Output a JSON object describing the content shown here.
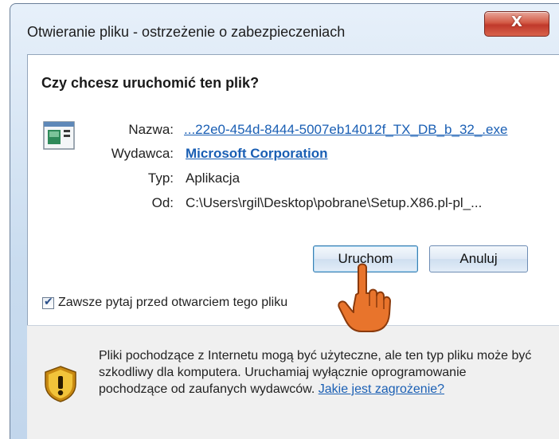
{
  "window": {
    "title": "Otwieranie pliku - ostrzeżenie o zabezpieczeniach",
    "close_glyph": "X"
  },
  "heading": "Czy chcesz uruchomić ten plik?",
  "file": {
    "icon": "application-file-icon",
    "name_label": "Nazwa:",
    "name_value": "...22e0-454d-8444-5007eb14012f_TX_DB_b_32_.exe",
    "publisher_label": "Wydawca:",
    "publisher_value": "Microsoft Corporation",
    "type_label": "Typ:",
    "type_value": "Aplikacja",
    "from_label": "Od:",
    "from_value": "C:\\Users\\rgil\\Desktop\\pobrane\\Setup.X86.pl-pl_..."
  },
  "buttons": {
    "run": "Uruchom",
    "cancel": "Anuluj"
  },
  "checkbox": {
    "label": "Zawsze pytaj przed otwarciem tego pliku",
    "checked": true
  },
  "warning": {
    "text": "Pliki pochodzące z Internetu mogą być użyteczne, ale ten typ pliku może być szkodliwy dla komputera. Uruchamiaj wyłącznie oprogramowanie pochodzące od zaufanych wydawców.",
    "link": "Jakie jest zagrożenie?",
    "icon": "security-shield-warning-icon"
  },
  "colors": {
    "link": "#1a5fb4",
    "pointer_hand": "#e8742c"
  }
}
